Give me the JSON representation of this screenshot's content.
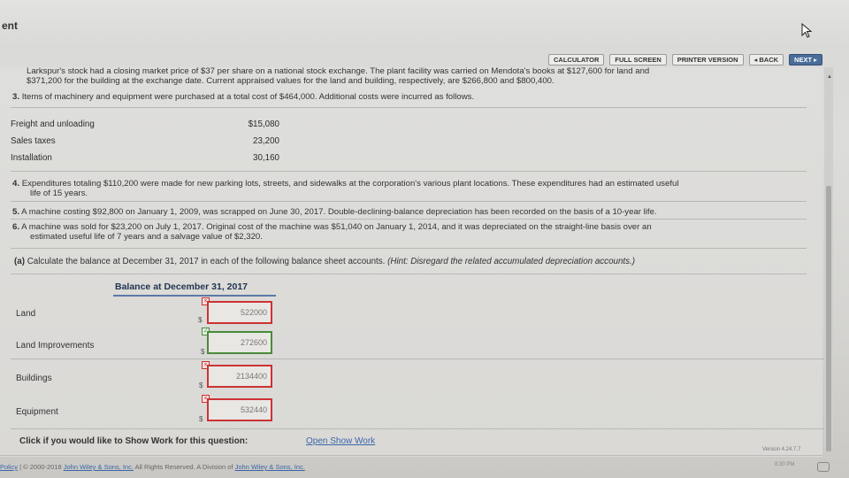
{
  "header": {
    "title": "ent"
  },
  "toolbar": {
    "calculator": "CALCULATOR",
    "full_screen": "FULL SCREEN",
    "printer_version": "PRINTER VERSION",
    "back": "◂ BACK",
    "next": "NEXT ▸"
  },
  "problem": {
    "intro_line1": "Larkspur's stock had a closing market price of $37 per share on a national stock exchange. The plant facility was carried on Mendota's books at $127,600 for land and",
    "intro_line2": "$371,200 for the building at the exchange date. Current appraised values for the land and building, respectively, are $266,800 and $800,400.",
    "item3_num": "3.",
    "item3_text": "Items of machinery and equipment were purchased at a total cost of $464,000. Additional costs were incurred as follows.",
    "costs": [
      {
        "label": "Freight and unloading",
        "value": "$15,080"
      },
      {
        "label": "Sales taxes",
        "value": "23,200"
      },
      {
        "label": "Installation",
        "value": "30,160"
      }
    ],
    "item4_num": "4.",
    "item4_line1": "Expenditures totaling $110,200 were made for new parking lots, streets, and sidewalks at the corporation's various plant locations. These expenditures had an estimated useful",
    "item4_line2": "life of 15 years.",
    "item5_num": "5.",
    "item5_text": "A machine costing $92,800 on January 1, 2009, was scrapped on June 30, 2017. Double-declining-balance depreciation has been recorded on the basis of a 10-year life.",
    "item6_num": "6.",
    "item6_line1": "A machine was sold for $23,200 on July 1, 2017. Original cost of the machine was $51,040 on January 1, 2014, and it was depreciated on the straight-line basis over an",
    "item6_line2": "estimated useful life of 7 years and a salvage value of $2,320."
  },
  "question": {
    "label": "(a)",
    "text": "Calculate the balance at December 31, 2017 in each of the following balance sheet accounts.",
    "hint": "(Hint: Disregard the related accumulated depreciation accounts.)"
  },
  "balance": {
    "header": "Balance at December 31, 2017",
    "currency": "$",
    "rows": [
      {
        "label": "Land",
        "value": "522000",
        "status": "incorrect",
        "mark": "×"
      },
      {
        "label": "Land Improvements",
        "value": "272600",
        "status": "correct",
        "mark": "✓"
      },
      {
        "label": "Buildings",
        "value": "2134400",
        "status": "incorrect",
        "mark": "×"
      },
      {
        "label": "Equipment",
        "value": "532440",
        "status": "incorrect",
        "mark": "×"
      }
    ]
  },
  "show_work": {
    "prompt": "Click if you would like to Show Work for this question:",
    "link": "Open Show Work"
  },
  "footer": {
    "policy": "Policy",
    "separator": "|",
    "copyright": "© 2000-2018",
    "company_link": "John Wiley & Sons, Inc.",
    "rights": "All Rights Reserved. A Division of",
    "division_link": "John Wiley & Sons, Inc.",
    "version": "Version 4.24.7.7",
    "time": "8:30 PM"
  }
}
